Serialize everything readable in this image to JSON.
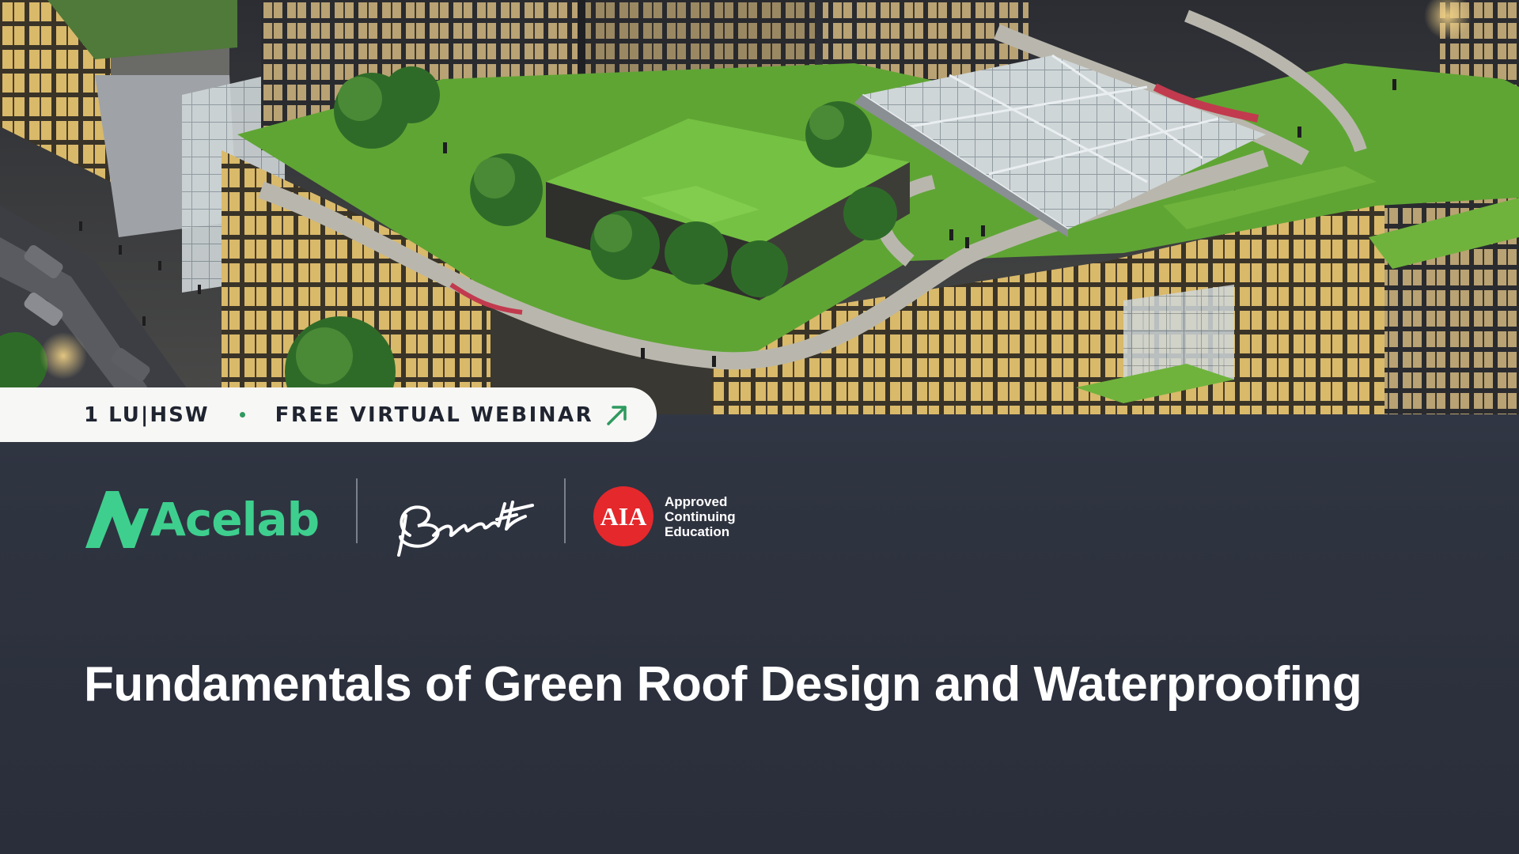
{
  "banner": {
    "credits": "1 LU|HSW",
    "label": "FREE VIRTUAL WEBINAR"
  },
  "logos": {
    "acelab": "Acelab",
    "barrett": "Barrett",
    "aia_badge": "AIA",
    "aia_lines": [
      "Approved",
      "Continuing",
      "Education"
    ]
  },
  "title": "Fundamentals of Green Roof Design and Waterproofing",
  "colors": {
    "acelab_green": "#3ecf8e",
    "aia_red": "#e4282c",
    "background": "#2f3441",
    "pill_background": "#f7f7f5"
  },
  "icons": {
    "banner_arrow": "arrow-up-right-icon",
    "acelab_mark": "acelab-logo-icon"
  }
}
